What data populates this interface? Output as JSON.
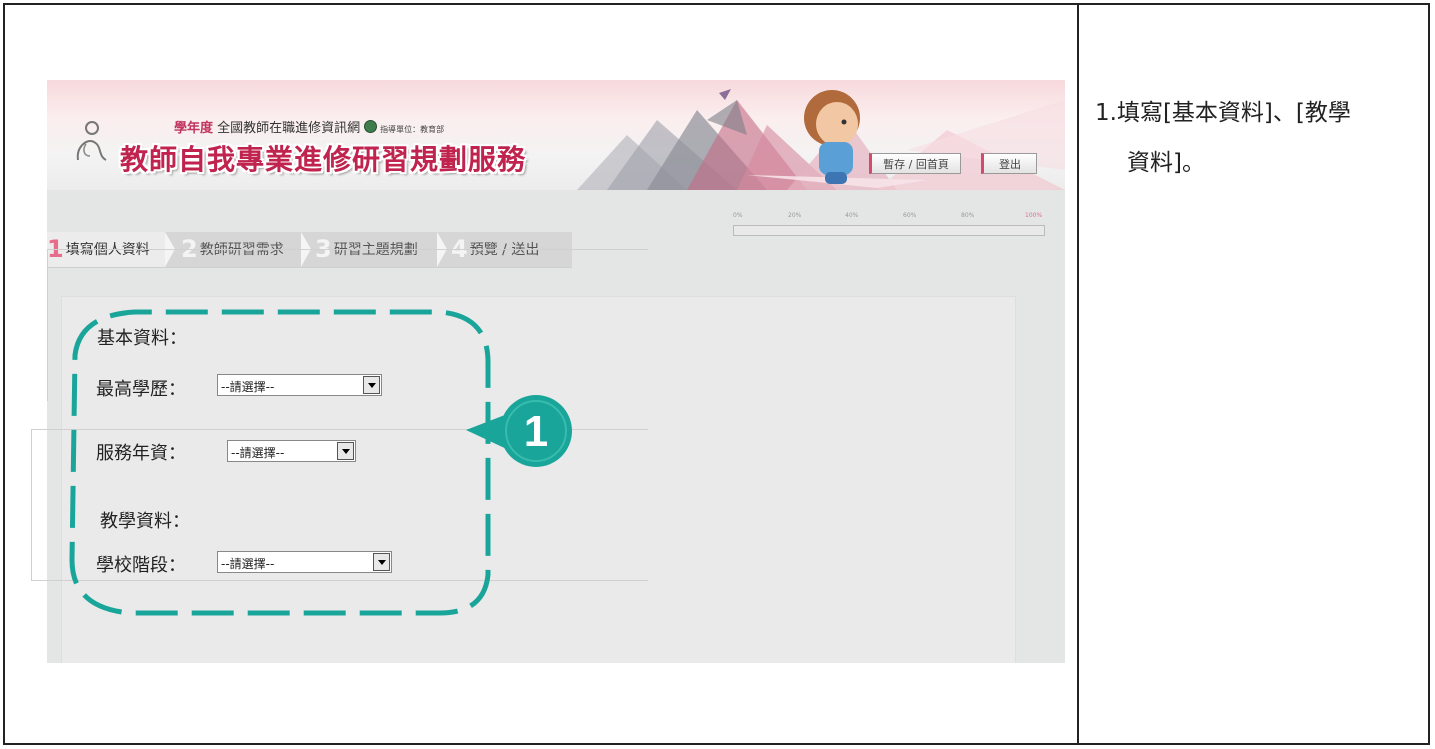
{
  "banner": {
    "year_label": "學年度",
    "network_name": "全國教師在職進修資訊網",
    "supervisor": "指導單位：教育部",
    "main_title": "教師自我專業進修研習規劃服務",
    "save_button": "暫存 / 回首頁",
    "logout_button": "登出"
  },
  "progress": {
    "ticks": [
      "0%",
      "20%",
      "40%",
      "60%",
      "80%",
      "100%"
    ],
    "value": 0
  },
  "steps": [
    {
      "num": "1",
      "label": "填寫個人資料",
      "active": true
    },
    {
      "num": "2",
      "label": "教師研習需求",
      "active": false
    },
    {
      "num": "3",
      "label": "研習主題規劃",
      "active": false
    },
    {
      "num": "4",
      "label": "預覽 / 送出",
      "active": false
    }
  ],
  "form": {
    "basic": {
      "legend": "基本資料：",
      "education_label": "最高學歷：",
      "education_value": "--請選擇--",
      "seniority_label": "服務年資：",
      "seniority_value": "--請選擇--"
    },
    "teaching": {
      "legend": "教學資料：",
      "school_level_label": "學校階段：",
      "school_level_value": "--請選擇--"
    }
  },
  "callout": {
    "number": "1",
    "color": "#1aa59a"
  },
  "instruction": {
    "line1": "1.填寫[基本資料]、[教學",
    "line2": "資料]。"
  }
}
